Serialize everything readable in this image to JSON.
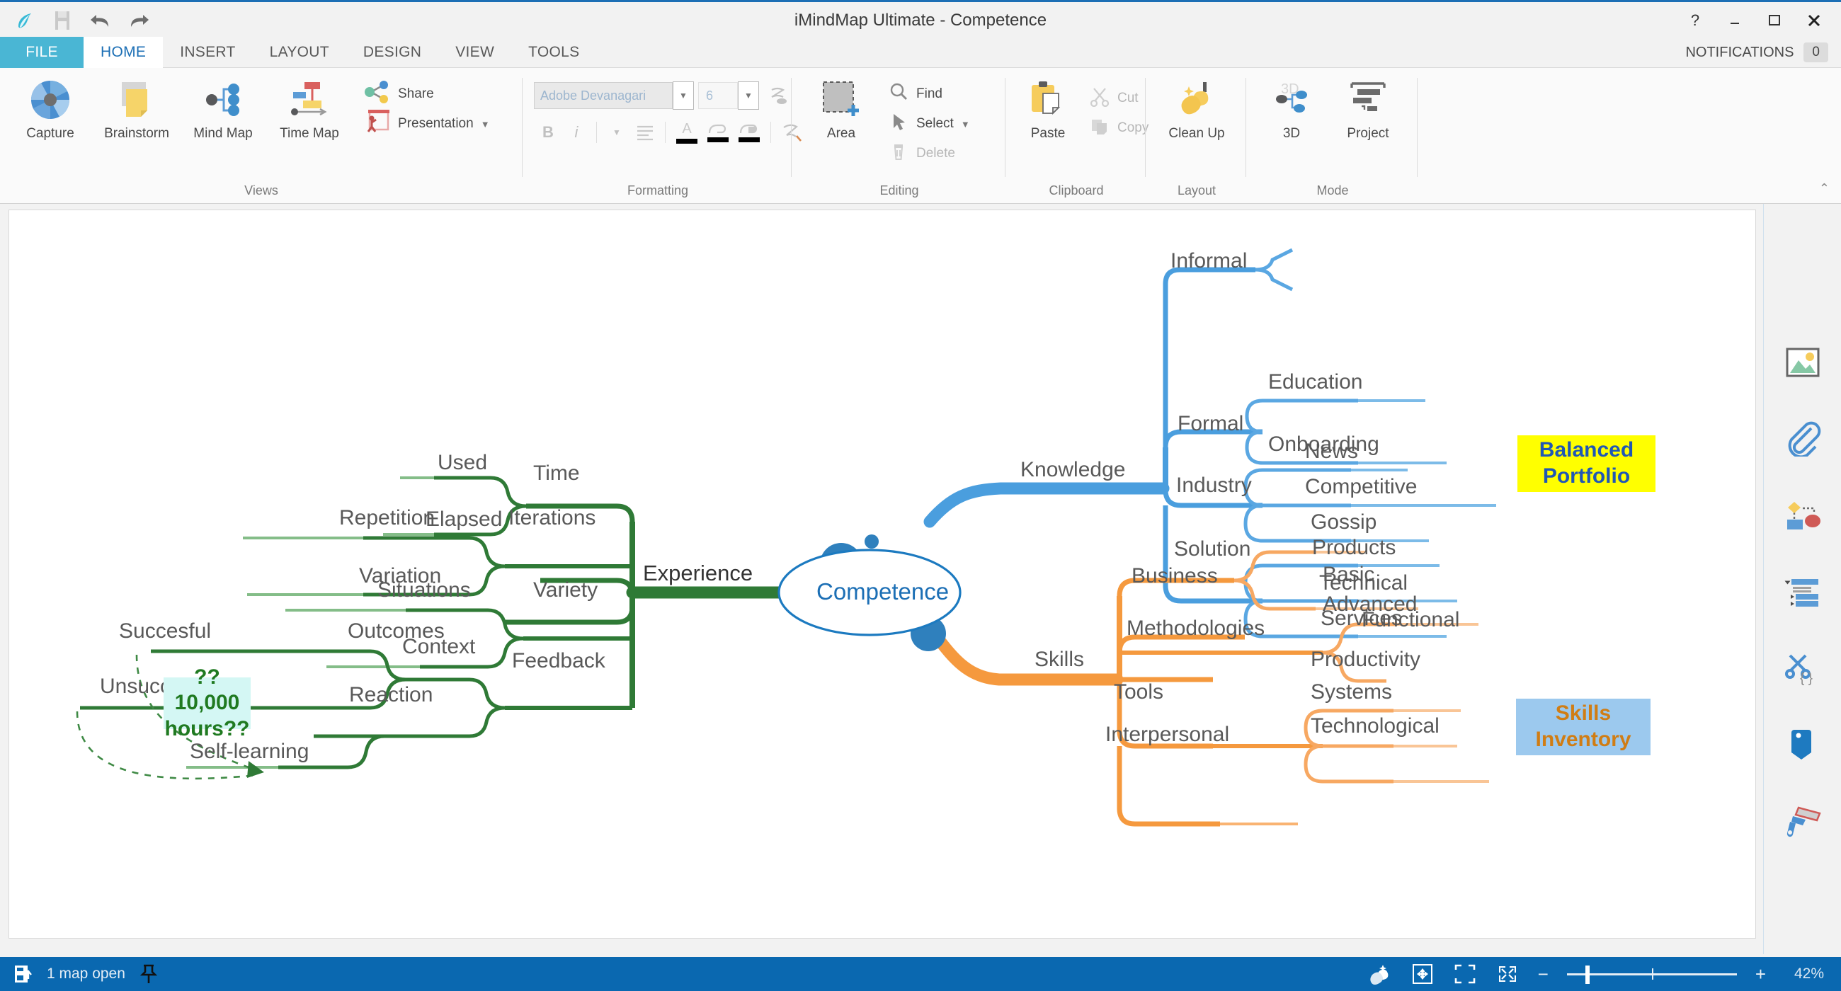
{
  "window": {
    "title": "iMindMap Ultimate - Competence",
    "help_icon": "?",
    "minimize_icon": "minimize-icon",
    "maximize_icon": "maximize-icon",
    "close_icon": "close-icon"
  },
  "quick_access": {
    "logo": "imindmap-logo",
    "save": "save-icon",
    "undo": "undo-icon",
    "redo": "redo-icon"
  },
  "tabs": [
    {
      "label": "FILE"
    },
    {
      "label": "HOME"
    },
    {
      "label": "INSERT"
    },
    {
      "label": "LAYOUT"
    },
    {
      "label": "DESIGN"
    },
    {
      "label": "VIEW"
    },
    {
      "label": "TOOLS"
    }
  ],
  "notifications": {
    "label": "NOTIFICATIONS",
    "count": "0"
  },
  "ribbon": {
    "groups": [
      {
        "name": "Views",
        "buttons": [
          {
            "label": "Capture"
          },
          {
            "label": "Brainstorm"
          },
          {
            "label": "Mind Map"
          },
          {
            "label": "Time Map"
          },
          {
            "label": "Share"
          },
          {
            "label": "Presentation"
          }
        ]
      },
      {
        "name": "Formatting",
        "font_value": "Adobe Devanagari",
        "font_size_value": "6",
        "bold": "B",
        "italic": "i"
      },
      {
        "name": "Editing",
        "buttons": [
          {
            "label": "Area"
          },
          {
            "label": "Find"
          },
          {
            "label": "Select"
          },
          {
            "label": "Delete"
          }
        ]
      },
      {
        "name": "Clipboard",
        "buttons": [
          {
            "label": "Paste"
          },
          {
            "label": "Cut"
          },
          {
            "label": "Copy"
          }
        ]
      },
      {
        "name": "Layout",
        "buttons": [
          {
            "label": "Clean Up"
          }
        ]
      },
      {
        "name": "Mode",
        "buttons": [
          {
            "label": "3D"
          },
          {
            "label": "Project"
          }
        ]
      }
    ],
    "collapse_icon": "chevron-up-icon"
  },
  "sidebar": {
    "items": [
      {
        "icon": "image-icon"
      },
      {
        "icon": "paperclip-icon"
      },
      {
        "icon": "flowchart-icon"
      },
      {
        "icon": "outline-icon"
      },
      {
        "icon": "snippet-scissors-icon"
      },
      {
        "icon": "tag-icon"
      },
      {
        "icon": "brush-icon"
      }
    ]
  },
  "mindmap": {
    "root": {
      "label": "Competence",
      "color": "#1c7ac0"
    },
    "branches": [
      {
        "label": "Experience",
        "color": "#2f7a36",
        "side": "left",
        "children": [
          {
            "label": "Time",
            "children": [
              {
                "label": "Used"
              },
              {
                "label": "Elapsed"
              }
            ]
          },
          {
            "label": "Iterations",
            "children": [
              {
                "label": "Repetition"
              },
              {
                "label": "Variation"
              }
            ]
          },
          {
            "label": "Variety",
            "children": [
              {
                "label": "Situations"
              },
              {
                "label": "Context"
              }
            ]
          },
          {
            "label": "Feedback",
            "children": [
              {
                "label": "Outcomes",
                "children": [
                  {
                    "label": "Succesful"
                  },
                  {
                    "label": "Unsuccesful"
                  }
                ]
              },
              {
                "label": "Reaction",
                "children": [
                  {
                    "label": "Self-learning"
                  }
                ]
              }
            ]
          }
        ]
      },
      {
        "label": "Knowledge",
        "color": "#4a9ede",
        "side": "right",
        "children": [
          {
            "label": "Informal",
            "children": []
          },
          {
            "label": "Formal",
            "children": [
              {
                "label": "Education"
              },
              {
                "label": "Onboarding"
              }
            ]
          },
          {
            "label": "Industry",
            "children": [
              {
                "label": "News"
              },
              {
                "label": "Competitive"
              },
              {
                "label": "Gossip"
              }
            ]
          },
          {
            "label": "Solution",
            "children": [
              {
                "label": "Products"
              },
              {
                "label": "Technical"
              },
              {
                "label": "Services"
              }
            ]
          }
        ]
      },
      {
        "label": "Skills",
        "color": "#f5993e",
        "side": "right",
        "children": [
          {
            "label": "Business",
            "children": [
              {
                "label": "Basic"
              },
              {
                "label": "Advanced"
              }
            ]
          },
          {
            "label": "Methodologies",
            "children": [
              {
                "label": "Functional"
              }
            ]
          },
          {
            "label": "Tools",
            "children": [
              {
                "label": "Productivity"
              },
              {
                "label": "Systems"
              },
              {
                "label": "Technological"
              }
            ]
          },
          {
            "label": "Interpersonal",
            "children": []
          }
        ]
      }
    ],
    "relationships": [
      {
        "from": "Succesful",
        "to": "Self-learning",
        "style": "dashed"
      },
      {
        "from": "Unsuccesful",
        "to": "Self-learning",
        "style": "dashed"
      }
    ],
    "textboxes": [
      {
        "id": "hours",
        "text": "??10,000\nhours??",
        "background": "#d4f7f4",
        "color": "#207a21"
      },
      {
        "id": "balanced",
        "text": "Balanced\nPortfolio",
        "background": "#ffff00",
        "color": "#2057b5"
      },
      {
        "id": "skills_inventory",
        "text": "Skills\nInventory",
        "background": "#9cc9ee",
        "color": "#d07d14"
      }
    ]
  },
  "statusbar": {
    "maps_open": "1 map open",
    "map_icon": "map-open-icon",
    "pin_icon": "pin-icon",
    "clean_icon": "clean-icon",
    "center_icon": "center-map-icon",
    "fit_icon": "fit-screen-icon",
    "fullscreen_icon": "fullscreen-icon",
    "zoom_out": "−",
    "zoom_in": "+",
    "zoom_level": "42%"
  }
}
